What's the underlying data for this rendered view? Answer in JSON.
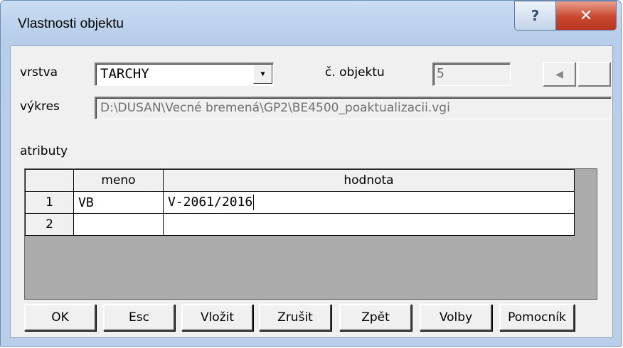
{
  "window": {
    "title": "Vlastnosti objektu",
    "help_glyph": "?",
    "close_glyph": "✕"
  },
  "form": {
    "layer_label": "vrstva",
    "layer_value": "TARCHY",
    "combo_arrow": "▼",
    "object_number_label": "č. objektu",
    "object_number_value": "5",
    "prev_glyph": "◀",
    "next_glyph": "",
    "drawing_label": "výkres",
    "drawing_path": "D:\\DUSAN\\Vecné bremená\\GP2\\BE4500_poaktualizacii.vgi",
    "attributes_label": "atributy"
  },
  "grid": {
    "columns": [
      "",
      "meno",
      "hodnota"
    ],
    "rows": [
      {
        "num": "1",
        "meno": "VB",
        "hodnota": "V-2061/2016"
      },
      {
        "num": "2",
        "meno": "",
        "hodnota": ""
      }
    ]
  },
  "buttons": {
    "ok": "OK",
    "esc": "Esc",
    "insert": "Vložit",
    "delete": "Zrušit",
    "back": "Zpět",
    "options": "Volby",
    "help": "Pomocník"
  }
}
